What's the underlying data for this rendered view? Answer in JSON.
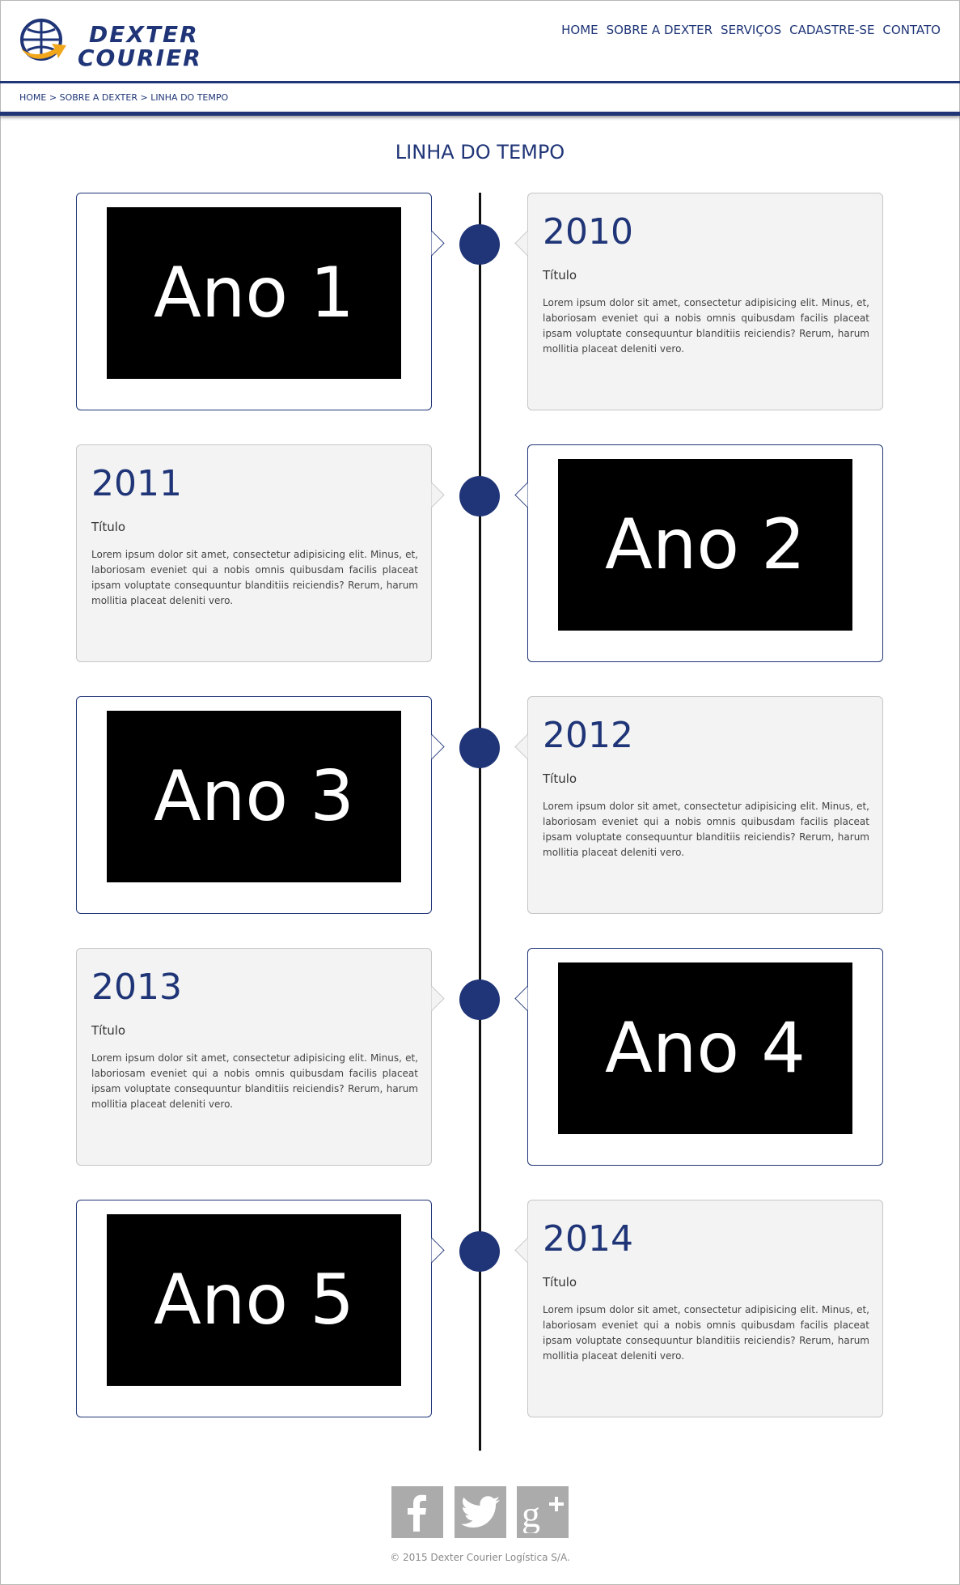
{
  "brand": {
    "line1": "DEXTER",
    "line2": "COURIER",
    "color": "#1f3577"
  },
  "nav": [
    "HOME",
    "SOBRE A DEXTER",
    "SERVIÇOS",
    "CADASTRE-SE",
    "CONTATO"
  ],
  "breadcrumb": {
    "home": "HOME",
    "sep": " > ",
    "about": "SOBRE A DEXTER",
    "current": "LINHA DO TEMPO"
  },
  "page_title": "LINHA DO TEMPO",
  "entries": [
    {
      "image_label": "Ano 1",
      "year": "2010",
      "title": "Título",
      "body": "Lorem ipsum dolor sit amet, consectetur adipisicing elit. Minus, et, laboriosam eveniet qui a nobis omnis quibusdam facilis placeat ipsam voluptate consequuntur blanditiis reiciendis? Rerum, harum mollitia placeat deleniti vero."
    },
    {
      "image_label": "Ano 2",
      "year": "2011",
      "title": "Título",
      "body": "Lorem ipsum dolor sit amet, consectetur adipisicing elit. Minus, et, laboriosam eveniet qui a nobis omnis quibusdam facilis placeat ipsam voluptate consequuntur blanditiis reiciendis? Rerum, harum mollitia placeat deleniti vero."
    },
    {
      "image_label": "Ano 3",
      "year": "2012",
      "title": "Título",
      "body": "Lorem ipsum dolor sit amet, consectetur adipisicing elit. Minus, et, laboriosam eveniet qui a nobis omnis quibusdam facilis placeat ipsam voluptate consequuntur blanditiis reiciendis? Rerum, harum mollitia placeat deleniti vero."
    },
    {
      "image_label": "Ano 4",
      "year": "2013",
      "title": "Título",
      "body": "Lorem ipsum dolor sit amet, consectetur adipisicing elit. Minus, et, laboriosam eveniet qui a nobis omnis quibusdam facilis placeat ipsam voluptate consequuntur blanditiis reiciendis? Rerum, harum mollitia placeat deleniti vero."
    },
    {
      "image_label": "Ano 5",
      "year": "2014",
      "title": "Título",
      "body": "Lorem ipsum dolor sit amet, consectetur adipisicing elit. Minus, et, laboriosam eveniet qui a nobis omnis quibusdam facilis placeat ipsam voluptate consequuntur blanditiis reiciendis? Rerum, harum mollitia placeat deleniti vero."
    }
  ],
  "social": [
    "facebook-icon",
    "twitter-icon",
    "google-plus-icon"
  ],
  "copyright": "© 2015 Dexter Courier Logística S/A."
}
